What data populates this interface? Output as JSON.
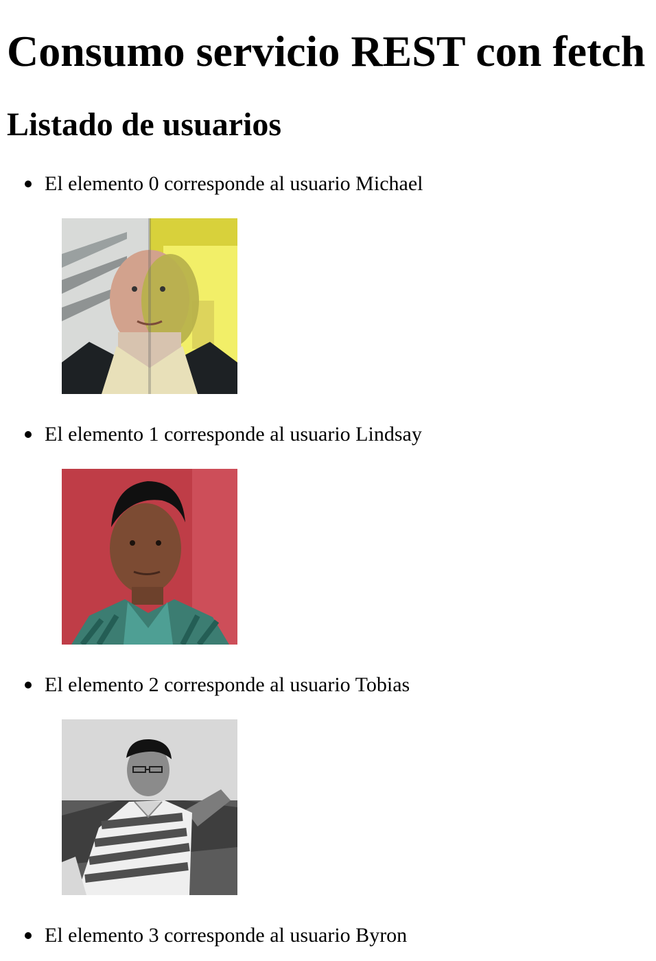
{
  "page": {
    "title": "Consumo servicio REST con fetch",
    "subtitle": "Listado de usuarios"
  },
  "users": [
    {
      "text": "El elemento 0 corresponde al usuario Michael"
    },
    {
      "text": "El elemento 1 corresponde al usuario Lindsay"
    },
    {
      "text": "El elemento 2 corresponde al usuario Tobias"
    },
    {
      "text": "El elemento 3 corresponde al usuario Byron"
    }
  ],
  "colors": {
    "text": "#000000",
    "background": "#ffffff"
  }
}
